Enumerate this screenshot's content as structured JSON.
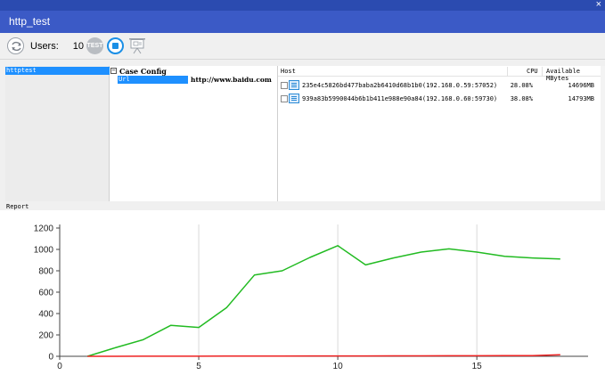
{
  "window": {
    "title": "http_test",
    "close_glyph": "×"
  },
  "toolbar": {
    "refresh_icon": "refresh-icon",
    "users_label": "Users:",
    "users_value": "10",
    "test_label": "TEST",
    "stop_icon": "stop-icon",
    "presentation_icon": "presentation-icon"
  },
  "tree": {
    "items": [
      {
        "label": "httptest"
      }
    ]
  },
  "case_config": {
    "toggle": "⊟",
    "title": "Case Config",
    "fields": [
      {
        "key": "Url",
        "value": "http://www.baidu.com"
      }
    ]
  },
  "hosts": {
    "columns": {
      "host": "Host",
      "cpu": "CPU",
      "memory": "Available MBytes"
    },
    "rows": [
      {
        "name": "235e4c5826bd477baba2b6410d68b1b0(192.168.0.59:57052)",
        "cpu": "28.08%",
        "memory": "14696MB"
      },
      {
        "name": "939a83b5990044b6b1b411e988e90a84(192.168.0.60:59730)",
        "cpu": "38.08%",
        "memory": "14793MB"
      }
    ]
  },
  "report": {
    "label": "Report"
  },
  "chart_data": {
    "type": "line",
    "title": "",
    "xlabel": "",
    "ylabel": "",
    "xlim": [
      0,
      19
    ],
    "ylim": [
      0,
      1200
    ],
    "xticks": [
      0,
      5,
      10,
      15
    ],
    "yticks": [
      0,
      200,
      400,
      600,
      800,
      1000,
      1200
    ],
    "grid": "vertical",
    "legend": "none",
    "series": [
      {
        "color": "#22bb22",
        "x": [
          1,
          2,
          3,
          4,
          5,
          6,
          7,
          8,
          9,
          10,
          11,
          12,
          13,
          14,
          15,
          16,
          17,
          18
        ],
        "y": [
          0,
          80,
          155,
          290,
          270,
          455,
          760,
          800,
          925,
          1035,
          855,
          920,
          975,
          1005,
          975,
          935,
          920,
          910
        ]
      },
      {
        "color": "#ee2222",
        "x": [
          1,
          2,
          3,
          4,
          5,
          6,
          7,
          8,
          9,
          10,
          11,
          12,
          13,
          14,
          15,
          16,
          17,
          18
        ],
        "y": [
          0,
          0,
          1,
          1,
          1,
          2,
          2,
          2,
          3,
          3,
          3,
          4,
          4,
          5,
          5,
          6,
          7,
          15
        ]
      }
    ]
  }
}
